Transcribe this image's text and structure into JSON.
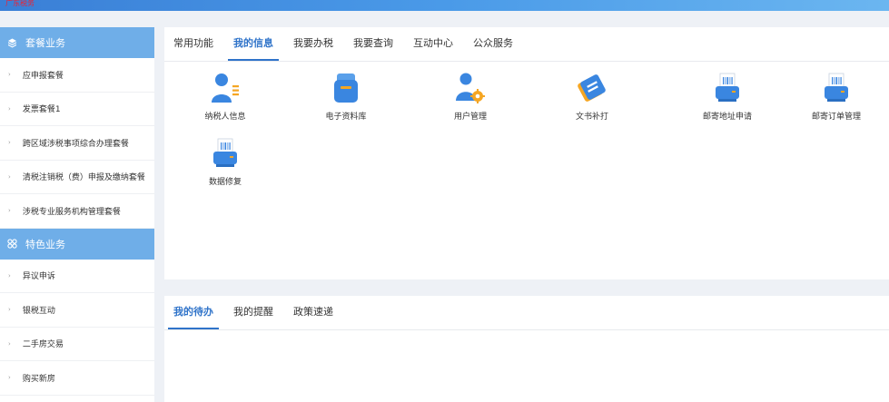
{
  "header": {
    "brand": "广东税务"
  },
  "sidebar": {
    "section1": {
      "title": "套餐业务",
      "icon": "cube-icon"
    },
    "items1": [
      {
        "label": "应申报套餐"
      },
      {
        "label": "发票套餐1"
      },
      {
        "label": "跨区域涉税事项综合办理套餐"
      },
      {
        "label": "清税注销税（费）申报及缴纳套餐"
      },
      {
        "label": "涉税专业服务机构管理套餐"
      }
    ],
    "section2": {
      "title": "特色业务",
      "icon": "grid-icon"
    },
    "items2": [
      {
        "label": "异议申诉"
      },
      {
        "label": "银税互动"
      },
      {
        "label": "二手房交易"
      },
      {
        "label": "购买新房"
      }
    ]
  },
  "main_tabs": [
    {
      "label": "常用功能"
    },
    {
      "label": "我的信息"
    },
    {
      "label": "我要办税"
    },
    {
      "label": "我要查询"
    },
    {
      "label": "互动中心"
    },
    {
      "label": "公众服务"
    }
  ],
  "main_active_tab": "我的信息",
  "tiles": [
    {
      "label": "纳税人信息",
      "icon": "taxpayer-info-icon"
    },
    {
      "label": "电子资料库",
      "icon": "electronic-archive-icon"
    },
    {
      "label": "用户管理",
      "icon": "user-management-icon"
    },
    {
      "label": "文书补打",
      "icon": "document-reprint-icon"
    },
    {
      "label": "邮寄地址申请",
      "icon": "mailing-address-icon"
    },
    {
      "label": "邮寄订单管理",
      "icon": "mail-order-icon"
    },
    {
      "label": "数据修复",
      "icon": "data-repair-icon"
    }
  ],
  "bottom_tabs": [
    {
      "label": "我的待办"
    },
    {
      "label": "我的提醒"
    },
    {
      "label": "政策速递"
    }
  ],
  "bottom_active_tab": "我的待办",
  "colors": {
    "accent": "#2f73c9",
    "sidebar_header": "#6faee8",
    "background": "#eef1f6"
  }
}
